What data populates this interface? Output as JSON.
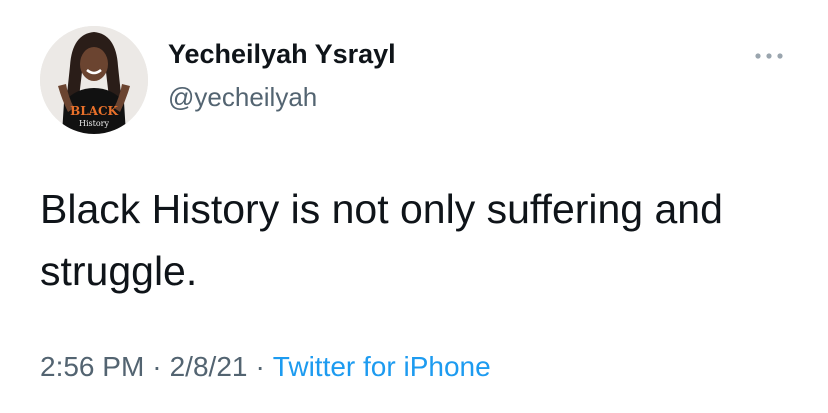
{
  "author": {
    "display_name": "Yecheilyah Ysrayl",
    "handle": "@yecheilyah",
    "avatar_shirt_text_1": "BLACK",
    "avatar_shirt_text_2": "History"
  },
  "tweet": {
    "text": "Black History is not only suffering and struggle.",
    "time": "2:56 PM",
    "date": "2/8/21",
    "separator": "·",
    "source": "Twitter for iPhone"
  },
  "icons": {
    "more": "more-horizontal-icon"
  },
  "colors": {
    "text": "#0f1419",
    "secondary": "#536471",
    "link": "#1d9bf0",
    "background": "#ffffff"
  }
}
